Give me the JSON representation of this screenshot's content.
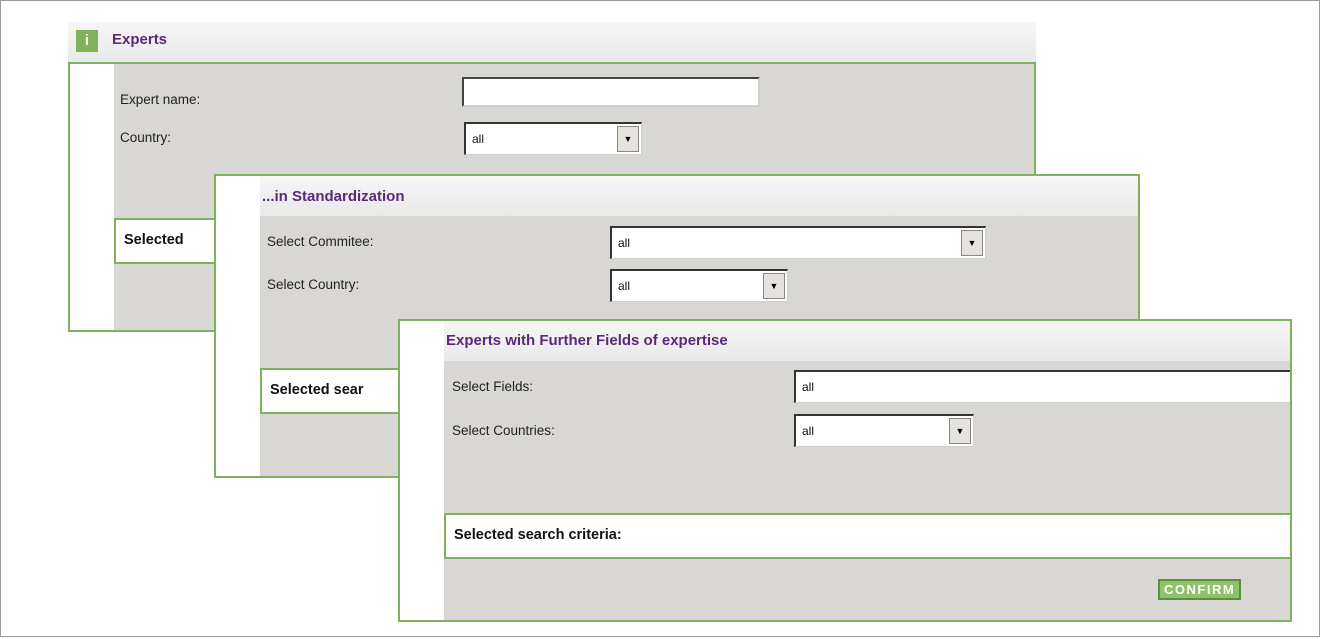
{
  "panel1": {
    "title": "Experts",
    "expert_name_label": "Expert name:",
    "expert_name_value": "",
    "country_label": "Country:",
    "country_value": "all",
    "criteria_label": "Selected"
  },
  "panel2": {
    "title": "...in Standardization",
    "committee_label": "Select Commitee:",
    "committee_value": "all",
    "country_label": "Select Country:",
    "country_value": "all",
    "criteria_label": "Selected sear"
  },
  "panel3": {
    "title": "Experts with Further Fields of expertise",
    "fields_label": "Select Fields:",
    "fields_value": "all",
    "countries_label": "Select Countries:",
    "countries_value": "all",
    "criteria_label": "Selected search criteria:",
    "confirm_label": "CONFIRM"
  },
  "icons": {
    "info": "info-icon",
    "dropdown": "triangle-down-icon"
  },
  "colors": {
    "accent_green": "#7fb25c",
    "title_purple": "#5a2a7a",
    "panel_gray": "#d9d7d4"
  }
}
